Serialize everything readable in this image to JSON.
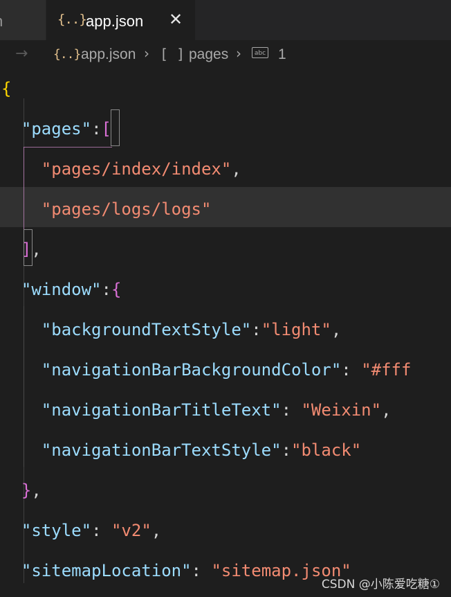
{
  "tabs": {
    "prev_label": "n",
    "active": {
      "icon_text": "{..}",
      "label": "app.json",
      "close_glyph": "✕"
    }
  },
  "breadcrumb": {
    "arrow": "→",
    "file_icon": "{..}",
    "file": "app.json",
    "sep": "›",
    "array_icon": "[ ]",
    "key": "pages",
    "string_icon": "abc",
    "index": "1"
  },
  "code": {
    "lines": [
      [
        {
          "t": "{",
          "c": "b1c"
        }
      ],
      [
        {
          "t": "  "
        },
        {
          "t": "\"pages\"",
          "c": "k"
        },
        {
          "t": ":",
          "c": "p"
        },
        {
          "t": "[",
          "c": "b2c"
        }
      ],
      [
        {
          "t": "    "
        },
        {
          "t": "\"pages/index/index\"",
          "c": "s"
        },
        {
          "t": ",",
          "c": "p"
        }
      ],
      [
        {
          "t": "    "
        },
        {
          "t": "\"pages/logs/logs\"",
          "c": "s"
        }
      ],
      [
        {
          "t": "  "
        },
        {
          "t": "]",
          "c": "b2c"
        },
        {
          "t": ",",
          "c": "p"
        }
      ],
      [
        {
          "t": "  "
        },
        {
          "t": "\"window\"",
          "c": "k"
        },
        {
          "t": ":",
          "c": "p"
        },
        {
          "t": "{",
          "c": "b2c"
        }
      ],
      [
        {
          "t": "    "
        },
        {
          "t": "\"backgroundTextStyle\"",
          "c": "k"
        },
        {
          "t": ":",
          "c": "p"
        },
        {
          "t": "\"light\"",
          "c": "s"
        },
        {
          "t": ",",
          "c": "p"
        }
      ],
      [
        {
          "t": "    "
        },
        {
          "t": "\"navigationBarBackgroundColor\"",
          "c": "k"
        },
        {
          "t": ": ",
          "c": "p"
        },
        {
          "t": "\"#fff",
          "c": "s"
        }
      ],
      [
        {
          "t": "    "
        },
        {
          "t": "\"navigationBarTitleText\"",
          "c": "k"
        },
        {
          "t": ": ",
          "c": "p"
        },
        {
          "t": "\"Weixin\"",
          "c": "s"
        },
        {
          "t": ",",
          "c": "p"
        }
      ],
      [
        {
          "t": "    "
        },
        {
          "t": "\"navigationBarTextStyle\"",
          "c": "k"
        },
        {
          "t": ":",
          "c": "p"
        },
        {
          "t": "\"black\"",
          "c": "s"
        }
      ],
      [
        {
          "t": "  "
        },
        {
          "t": "}",
          "c": "b2c"
        },
        {
          "t": ",",
          "c": "p"
        }
      ],
      [
        {
          "t": "  "
        },
        {
          "t": "\"style\"",
          "c": "k"
        },
        {
          "t": ": ",
          "c": "p"
        },
        {
          "t": "\"v2\"",
          "c": "s"
        },
        {
          "t": ",",
          "c": "p"
        }
      ],
      [
        {
          "t": "  "
        },
        {
          "t": "\"sitemapLocation\"",
          "c": "k"
        },
        {
          "t": ": ",
          "c": "p"
        },
        {
          "t": "\"sitemap.json\"",
          "c": "s"
        }
      ]
    ]
  },
  "colors": {
    "key": "#9cdcfe",
    "string": "#f28b72",
    "bracket_level1": "#ffd700",
    "bracket_level2": "#da70d6",
    "json_icon": "#e2c08d",
    "editor_bg": "#1e1e1e",
    "highlight_line": "#313131"
  },
  "watermark": "CSDN @小陈爱吃糖①"
}
